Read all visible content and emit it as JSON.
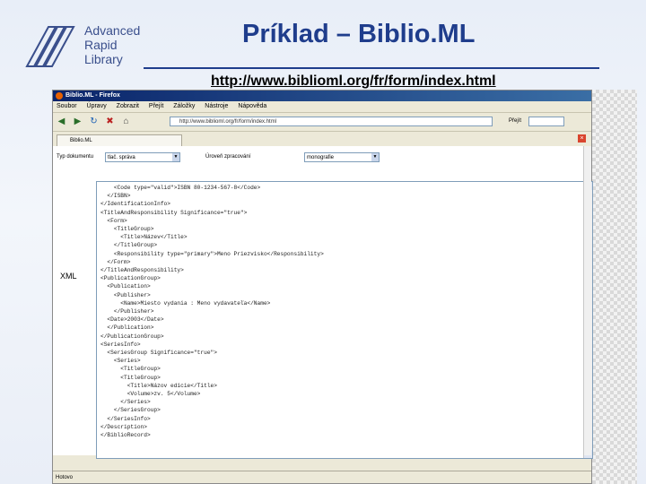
{
  "logo": {
    "line1": "Advanced",
    "line2": "Rapid",
    "line3": "Library"
  },
  "slide": {
    "title": "Príklad – Biblio.ML",
    "url": "http://www.biblioml.org/fr/form/index.html"
  },
  "browser": {
    "window_title": "Biblio.ML - Firefox",
    "menu": [
      "Soubor",
      "Úpravy",
      "Zobrazit",
      "Přejít",
      "Záložky",
      "Nástroje",
      "Nápověda"
    ],
    "address": "http://www.biblioml.org/fr/form/index.html",
    "go_label": "Přejít",
    "tab_label": "Biblio.ML",
    "status": "Hotovo"
  },
  "form": {
    "doc_type_label": "Typ dokumentu",
    "doc_type_value": "tlač. správa",
    "level_label": "Úroveň zpracování",
    "level_value": "monografie",
    "xml_label": "XML"
  },
  "xml_lines": [
    "    <Code type=\"valid\">ISBN 80-1234-567-8</Code>",
    "  </ISBN>",
    "</IdentificationInfo>",
    "<TitleAndResponsibility Significance=\"true\">",
    "  <Form>",
    "    <TitleGroup>",
    "      <Title>Název</Title>",
    "    </TitleGroup>",
    "    <Responsibility type=\"primary\">Meno Priezvisko</Responsibility>",
    "  </Form>",
    "</TitleAndResponsibility>",
    "<PublicationGroup>",
    "  <Publication>",
    "    <Publisher>",
    "      <Name>Miesto vydania : Meno vydavateľa</Name>",
    "    </Publisher>",
    "  <Date>2003</Date>",
    "  </Publication>",
    "</PublicationGroup>",
    "<SeriesInfo>",
    "  <SeriesGroup Significance=\"true\">",
    "    <Series>",
    "      <TitleGroup>",
    "      <TitleGroup>",
    "        <Title>Názov edície</Title>",
    "        <Volume>zv. 5</Volume>",
    "      </Series>",
    "    </SeriesGroup>",
    "  </SeriesInfo>",
    "</Description>",
    "</BiblioRecord>"
  ]
}
